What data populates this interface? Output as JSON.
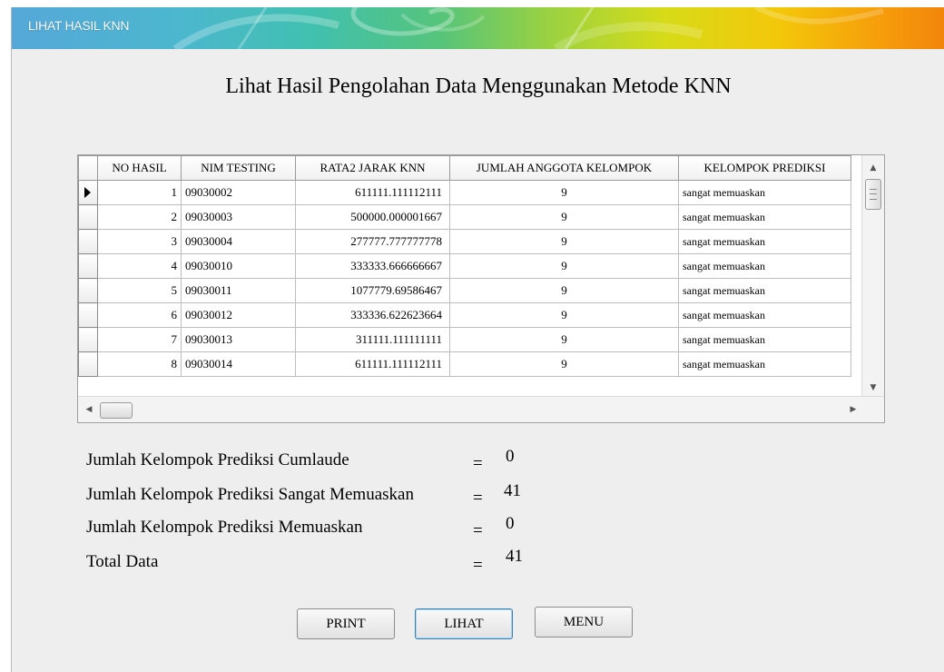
{
  "window": {
    "title": "LIHAT HASIL KNN"
  },
  "heading": "Lihat Hasil Pengolahan Data Menggunakan Metode KNN",
  "table": {
    "columns": [
      "NO HASIL",
      "NIM TESTING",
      "RATA2 JARAK KNN",
      "JUMLAH ANGGOTA KELOMPOK",
      "KELOMPOK PREDIKSI"
    ],
    "rows": [
      [
        "1",
        "09030002",
        "611111.111112111",
        "9",
        "sangat memuaskan"
      ],
      [
        "2",
        "09030003",
        "500000.000001667",
        "9",
        "sangat memuaskan"
      ],
      [
        "3",
        "09030004",
        "277777.777777778",
        "9",
        "sangat memuaskan"
      ],
      [
        "4",
        "09030010",
        "333333.666666667",
        "9",
        "sangat memuaskan"
      ],
      [
        "5",
        "09030011",
        "1077779.69586467",
        "9",
        "sangat memuaskan"
      ],
      [
        "6",
        "09030012",
        "333336.622623664",
        "9",
        "sangat memuaskan"
      ],
      [
        "7",
        "09030013",
        "311111.111111111",
        "9",
        "sangat memuaskan"
      ],
      [
        "8",
        "09030014",
        "611111.111112111",
        "9",
        "sangat memuaskan"
      ]
    ],
    "selected_row_icon": "row-pointer-icon"
  },
  "summary": [
    {
      "label": "Jumlah Kelompok Prediksi Cumlaude",
      "eq": "=",
      "value": "0"
    },
    {
      "label": "Jumlah Kelompok Prediksi Sangat Memuaskan",
      "eq": "=",
      "value": "41"
    },
    {
      "label": "Jumlah Kelompok Prediksi Memuaskan",
      "eq": "=",
      "value": "0"
    },
    {
      "label": "Total Data",
      "eq": "=",
      "value": "41"
    }
  ],
  "buttons": {
    "print": "PRINT",
    "lihat": "LIHAT",
    "menu": "MENU"
  },
  "colors": {
    "titlebar_start": "#55a8d8",
    "titlebar_end": "#f2850b",
    "window_bg": "#eeeeee",
    "focus_border": "#3c7fb1"
  }
}
